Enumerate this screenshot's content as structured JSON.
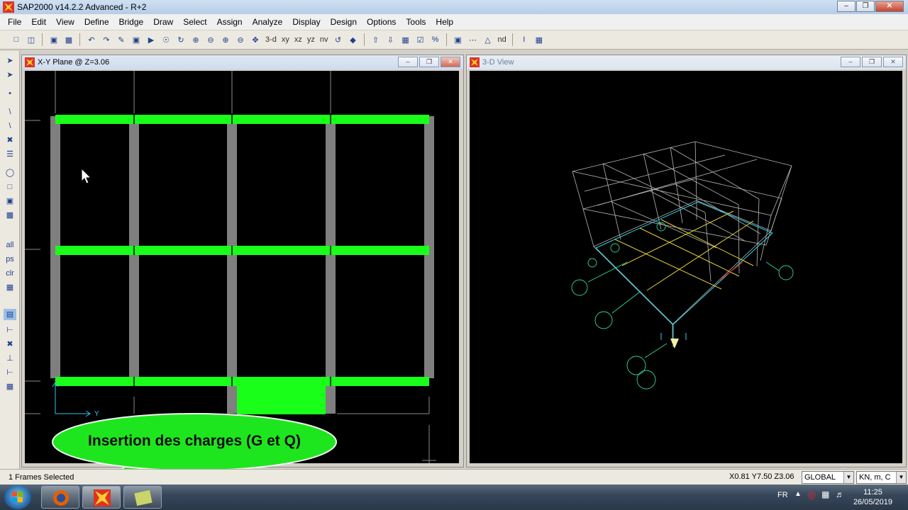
{
  "window": {
    "title": "SAP2000 v14.2.2 Advanced  -  R+2"
  },
  "menu": [
    "File",
    "Edit",
    "View",
    "Define",
    "Bridge",
    "Draw",
    "Select",
    "Assign",
    "Analyze",
    "Display",
    "Design",
    "Options",
    "Tools",
    "Help"
  ],
  "toolbar": {
    "view_3d": "3-d",
    "view_xy": "xy",
    "view_xz": "xz",
    "view_yz": "yz",
    "view_nv": "nv",
    "view_nd": "nd"
  },
  "left_tools": {
    "all": "all",
    "ps": "ps",
    "clr": "clr"
  },
  "plan_window": {
    "title": "X-Y Plane @ Z=3.06",
    "axis_y": "Y"
  },
  "view3d_window": {
    "title": "3-D View"
  },
  "callout": {
    "text": "Insertion des charges (G et Q)"
  },
  "status": {
    "selection": "1 Frames Selected",
    "coordinates": "X0.81  Y7.50  Z3.06",
    "coord_system": "GLOBAL",
    "units": "KN, m, C"
  },
  "taskbar": {
    "language": "FR",
    "time": "11:25",
    "date": "26/05/2019"
  },
  "colors": {
    "beam": "#19ff19",
    "column": "#808080",
    "canvas": "#000000",
    "callout_fill": "#1ee61e"
  }
}
